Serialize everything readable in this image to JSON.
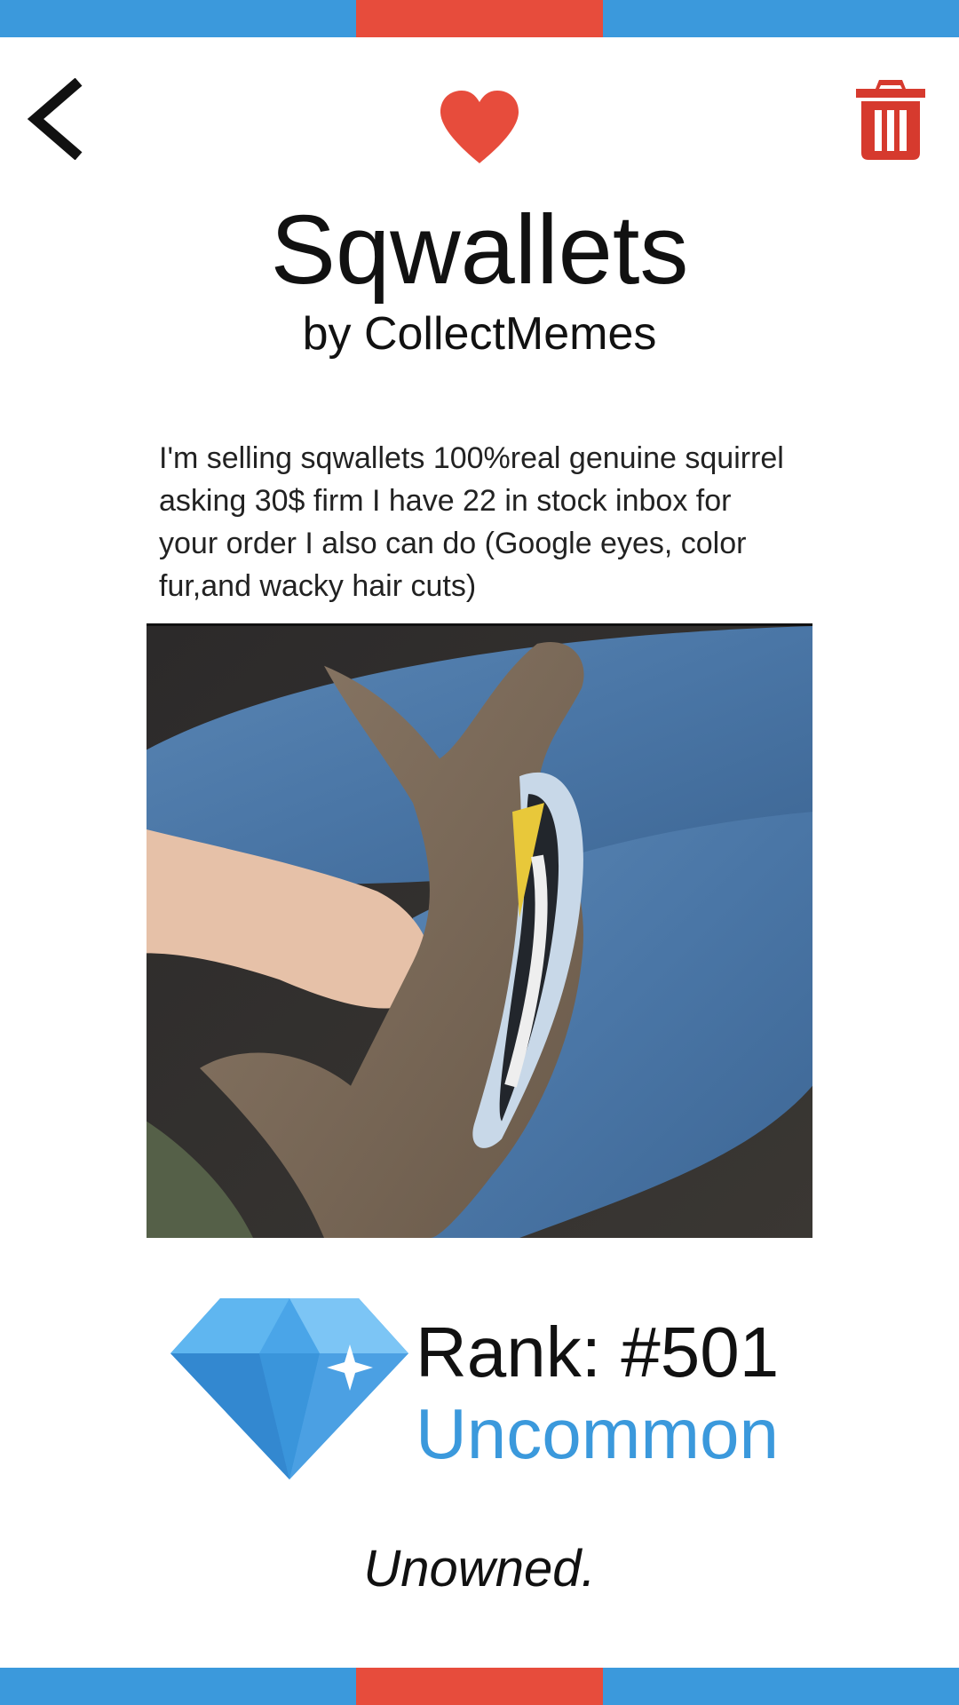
{
  "colors": {
    "accent_blue": "#3b99dc",
    "accent_red": "#e74c3c",
    "text": "#111111"
  },
  "header": {
    "back_icon": "chevron-left-icon",
    "favorite_icon": "heart-icon",
    "delete_icon": "trash-icon"
  },
  "meme": {
    "title": "Sqwallets",
    "author": "by CollectMemes",
    "caption": "I'm selling sqwallets 100%real genuine squirrel asking 30$ firm I have 22 in stock inbox for your order I also can do (Google eyes, color fur,and wacky hair cuts)"
  },
  "rarity": {
    "icon": "diamond-icon",
    "rank": "Rank: #501",
    "tier": "Uncommon"
  },
  "ownership": {
    "status": "Unowned."
  }
}
